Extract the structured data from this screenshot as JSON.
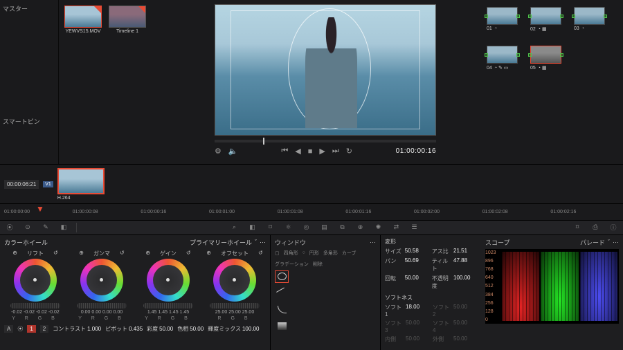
{
  "media_pool": {
    "master": "マスター",
    "smartbin": "スマートビン"
  },
  "clips": [
    {
      "label": "YEWVS15.MOV"
    },
    {
      "label": "Timeline 1"
    }
  ],
  "viewer": {
    "timecode": "01:00:00:16",
    "transport_icons": {
      "first": "⏮",
      "prev": "◀",
      "stop": "■",
      "play": "▶",
      "next": "⏭",
      "loop": "↻"
    },
    "options_icon": "⚙",
    "audio_icon": "🔈"
  },
  "nodes": [
    {
      "id": "01",
      "icons": "◔"
    },
    {
      "id": "02",
      "icons": "◔ ▦"
    },
    {
      "id": "03",
      "icons": "◔"
    },
    {
      "id": "04",
      "icons": "◔ ✎ ▭"
    },
    {
      "id": "05",
      "icons": "◔ ▦",
      "selected": true,
      "gray": true
    }
  ],
  "thumb_row": {
    "tc": "00:00:06:21",
    "track": "V1",
    "codec": "H.264"
  },
  "ruler": [
    "01:00:00:00",
    "01:00:00:08",
    "01:00:00:16",
    "01:00:01:00",
    "01:00:01:08",
    "01:00:01:16",
    "01:00:02:00",
    "01:00:02:08",
    "01:00:02:16"
  ],
  "toolstrip": {
    "right_icons": [
      "⌕",
      "◧",
      "⌑",
      "⚛",
      "◎",
      "▤",
      "⧉",
      "⊕",
      "✺",
      "⇄",
      "☰"
    ],
    "far_right": [
      "⌑",
      "⎙",
      "ⓘ"
    ]
  },
  "wheels": {
    "panel_title": "カラーホイール",
    "mode_label": "プライマリーホイール",
    "groups": [
      {
        "name": "リフト",
        "vals": "-0.02 -0.02 -0.02 -0.02"
      },
      {
        "name": "ガンマ",
        "vals": "0.00 0.00 0.00 0.00"
      },
      {
        "name": "ゲイン",
        "vals": "1.45 1.45 1.45 1.45"
      },
      {
        "name": "オフセット",
        "vals": "25.00 25.00 25.00"
      }
    ],
    "yrgb": "Y R G B",
    "rgb": "R G B",
    "footer": {
      "auto": "A",
      "picker": "⦿",
      "page1": "1",
      "page2": "2",
      "contrast_l": "コントラスト",
      "contrast_v": "1.000",
      "pivot_l": "ピボット",
      "pivot_v": "0.435",
      "sat_l": "彩度",
      "sat_v": "50.00",
      "hue_l": "色相",
      "hue_v": "50.00",
      "lummix_l": "輝度ミックス",
      "lummix_v": "100.00"
    }
  },
  "window": {
    "title": "ウィンドウ",
    "tabs": [
      "四角形",
      "円形",
      "多角形",
      "カーブ",
      "グラデーション"
    ],
    "delete": "削除",
    "shapes": [
      "circle",
      "line",
      "curve",
      "grad"
    ]
  },
  "params": {
    "transform_title": "変形",
    "transform": [
      {
        "l": "サイズ",
        "v": "50.58",
        "l2": "アス比",
        "v2": "21.51"
      },
      {
        "l": "パン",
        "v": "50.69",
        "l2": "ティルト",
        "v2": "47.88"
      },
      {
        "l": "回転",
        "v": "50.00",
        "l2": "不透明度",
        "v2": "100.00"
      }
    ],
    "soft_title": "ソフトネス",
    "soft": [
      {
        "l": "ソフト1",
        "v": "18.00",
        "l2": "ソフト2",
        "v2": "50.00",
        "dim2": true
      },
      {
        "l": "ソフト3",
        "v": "50.00",
        "l2": "ソフト4",
        "v2": "50.00",
        "dim": true,
        "dim2": true
      },
      {
        "l": "内側",
        "v": "50.00",
        "l2": "外側",
        "v2": "50.00",
        "dim": true,
        "dim2": true
      }
    ]
  },
  "scope": {
    "title": "スコープ",
    "mode": "パレード",
    "axis": [
      "1023",
      "896",
      "768",
      "640",
      "512",
      "384",
      "256",
      "128",
      "0"
    ]
  }
}
